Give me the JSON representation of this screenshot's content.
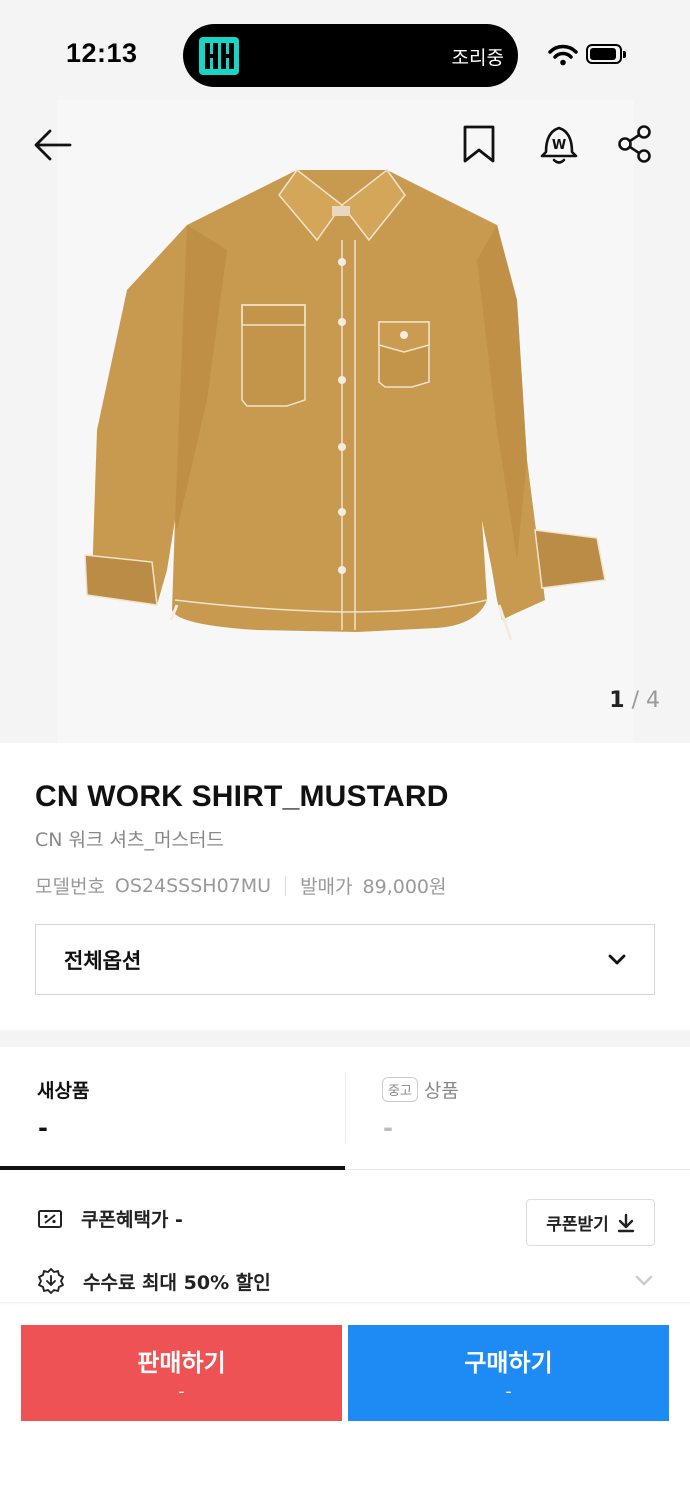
{
  "status_bar": {
    "time": "12:13",
    "island_app_text": "조리중",
    "island_logo": "app-logo-icon",
    "icons": [
      "wifi-icon",
      "battery-icon"
    ]
  },
  "top_bar": {
    "icons": [
      "back-arrow-icon",
      "bookmark-icon",
      "price-alert-icon",
      "share-icon"
    ],
    "price_alert_glyph": "W"
  },
  "gallery": {
    "current": "1",
    "separator": "/",
    "total": "4",
    "image_subject": "mustard work shirt"
  },
  "product": {
    "title": "CN WORK SHIRT_MUSTARD",
    "subtitle": "CN 워크 셔츠_머스터드",
    "model_label": "모델번호",
    "model_value": "OS24SSSH07MU",
    "release_label": "발매가",
    "release_value": "89,000원"
  },
  "option_select": {
    "label": "전체옵션"
  },
  "price_tabs": {
    "new": {
      "label": "새상품",
      "value": "-"
    },
    "used": {
      "badge": "중고",
      "label": "상품",
      "value": "-"
    },
    "selected": "new"
  },
  "benefits": {
    "coupon_text": "쿠폰혜택가 -",
    "coupon_button": "쿠폰받기",
    "fee_text": "수수료 최대 50% 할인"
  },
  "actions": {
    "sell_label": "판매하기",
    "sell_sub": "-",
    "buy_label": "구매하기",
    "buy_sub": "-"
  },
  "colors": {
    "sell": "#ef5254",
    "buy": "#1e8af4",
    "shirt": "#c89a4f",
    "island_logo": "#19d3c5"
  }
}
